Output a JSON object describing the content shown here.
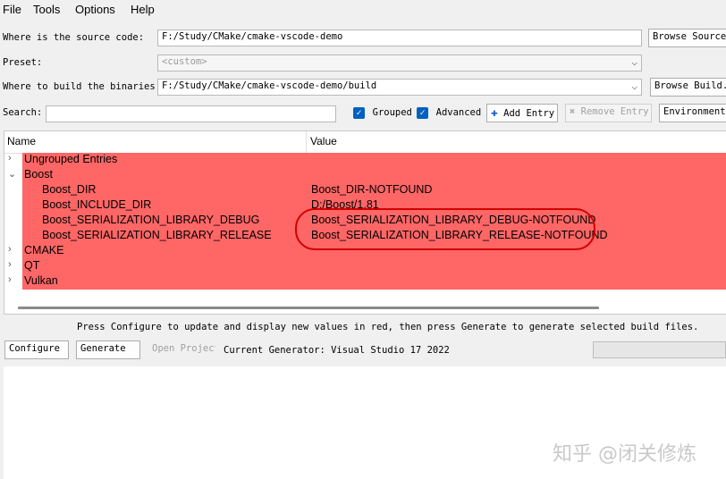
{
  "menu": [
    "File",
    "Tools",
    "Options",
    "Help"
  ],
  "source": {
    "label": "Where is the source code:",
    "value": "F:/Study/CMake/cmake-vscode-demo",
    "browse": "Browse Source..."
  },
  "preset": {
    "label": "Preset:",
    "value": "<custom>"
  },
  "build": {
    "label": "Where to build the binaries:",
    "value": "F:/Study/CMake/cmake-vscode-demo/build",
    "browse": "Browse Build..."
  },
  "search": {
    "label": "Search:",
    "value": ""
  },
  "options": {
    "grouped": "Grouped",
    "advanced": "Advanced",
    "add_entry": "Add Entry",
    "remove_entry": "Remove Entry",
    "environment": "Environment..."
  },
  "table": {
    "col_name": "Name",
    "col_value": "Value",
    "rows": [
      {
        "name": "Ungrouped Entries",
        "value": ""
      },
      {
        "name": "Boost",
        "value": ""
      },
      {
        "name": "Boost_DIR",
        "value": "Boost_DIR-NOTFOUND"
      },
      {
        "name": "Boost_INCLUDE_DIR",
        "value": "D:/Boost/1.81"
      },
      {
        "name": "Boost_SERIALIZATION_LIBRARY_DEBUG",
        "value": "Boost_SERIALIZATION_LIBRARY_DEBUG-NOTFOUND"
      },
      {
        "name": "Boost_SERIALIZATION_LIBRARY_RELEASE",
        "value": "Boost_SERIALIZATION_LIBRARY_RELEASE-NOTFOUND"
      },
      {
        "name": "CMAKE",
        "value": ""
      },
      {
        "name": "QT",
        "value": ""
      },
      {
        "name": "Vulkan",
        "value": ""
      }
    ]
  },
  "hint": "Press Configure to update and display new values in red, then press Generate to generate selected build files.",
  "actions": {
    "configure": "Configure",
    "generate": "Generate",
    "open_project": "Open Project",
    "generator": "Current Generator: Visual Studio 17 2022"
  },
  "watermark": "知乎 @闭关修炼",
  "colors": {
    "changed_row": "#ff6666",
    "annotation": "#d10000",
    "checkbox": "#0060c0"
  }
}
